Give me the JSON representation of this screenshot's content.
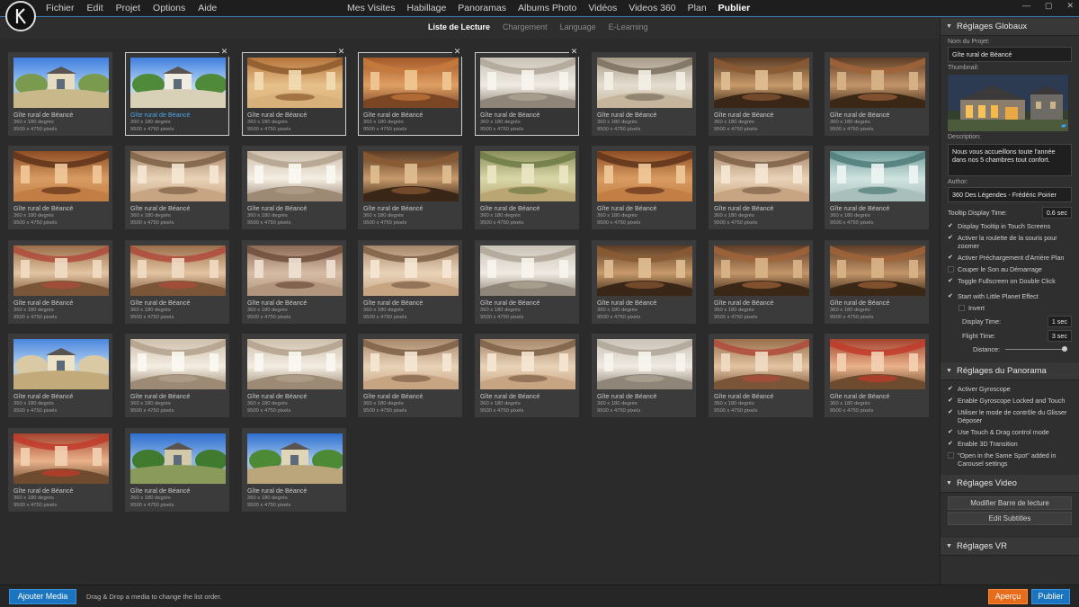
{
  "menu": {
    "left": [
      "Fichier",
      "Edit",
      "Projet",
      "Options",
      "Aide"
    ],
    "center": [
      "Mes Visites",
      "Habillage",
      "Panoramas",
      "Albums Photo",
      "Vidéos",
      "Videos 360",
      "Plan",
      "Publier"
    ],
    "active": "Publier"
  },
  "subtabs": {
    "items": [
      "Liste de Lecture",
      "Chargement",
      "Language",
      "E-Learning"
    ],
    "active": "Liste de Lecture"
  },
  "window_controls": [
    "—",
    "▢",
    "✕"
  ],
  "media": {
    "title": "Gîte rural de Béancé",
    "line2": "360 x 180 degrés",
    "line3": "9500 x 4750 pixels",
    "items": [
      {
        "scene": "ext-garden",
        "selected": false,
        "closable": false
      },
      {
        "scene": "ext-door",
        "selected": true,
        "blue": true,
        "closable": true
      },
      {
        "scene": "int-warm",
        "selected": true,
        "closable": true
      },
      {
        "scene": "int-orange",
        "selected": true,
        "closable": true
      },
      {
        "scene": "int-white",
        "selected": true,
        "closable": true
      },
      {
        "scene": "int-kitchen",
        "selected": false,
        "closable": false
      },
      {
        "scene": "int-beams",
        "selected": false,
        "closable": false
      },
      {
        "scene": "int-beams2",
        "selected": false,
        "closable": false
      },
      {
        "scene": "int-stairs",
        "selected": false
      },
      {
        "scene": "int-room",
        "selected": false
      },
      {
        "scene": "int-light",
        "selected": false
      },
      {
        "scene": "int-beams",
        "selected": false
      },
      {
        "scene": "int-green",
        "selected": false
      },
      {
        "scene": "int-stairs",
        "selected": false
      },
      {
        "scene": "int-room",
        "selected": false
      },
      {
        "scene": "int-teal",
        "selected": false
      },
      {
        "scene": "int-bed",
        "selected": false
      },
      {
        "scene": "int-bed",
        "selected": false
      },
      {
        "scene": "int-attic",
        "selected": false
      },
      {
        "scene": "int-room",
        "selected": false
      },
      {
        "scene": "int-white",
        "selected": false
      },
      {
        "scene": "int-beams",
        "selected": false
      },
      {
        "scene": "int-beams2",
        "selected": false
      },
      {
        "scene": "int-beams2",
        "selected": false
      },
      {
        "scene": "ext-court",
        "selected": false
      },
      {
        "scene": "int-light",
        "selected": false
      },
      {
        "scene": "int-light",
        "selected": false
      },
      {
        "scene": "int-room",
        "selected": false
      },
      {
        "scene": "int-room",
        "selected": false
      },
      {
        "scene": "int-white",
        "selected": false
      },
      {
        "scene": "int-bed",
        "selected": false
      },
      {
        "scene": "int-red",
        "selected": false
      },
      {
        "scene": "int-red",
        "selected": false
      },
      {
        "scene": "ext-garden2",
        "selected": false
      },
      {
        "scene": "ext-path",
        "selected": false
      }
    ]
  },
  "panel": {
    "global_title": "Réglages Globaux",
    "project_name_label": "Nom du Projet:",
    "project_name": "Gîte rural de Béancé",
    "thumbnail_label": "Thumbnail:",
    "description_label": "Description:",
    "description": "Nous vous accueillons toute l'année dans nos 5 chambres tout confort.",
    "author_label": "Author:",
    "author": "360 Des Légendes - Frédéric Poirier",
    "tooltip_label": "Tooltip Display Time:",
    "tooltip_value": "0.6 sec",
    "global_checks": [
      {
        "label": "Display Tooltip in Touch Screens",
        "checked": true
      },
      {
        "label": "Activer la roulette de la souris pour zoomer",
        "checked": true
      },
      {
        "label": "Activer Préchargement d'Arrière Plan",
        "checked": true
      },
      {
        "label": "Couper le Son au Démarrage",
        "checked": false
      },
      {
        "label": "Toggle Fullscreen on Double Click",
        "checked": true
      }
    ],
    "little_planet_label": "Start with Little Planet Effect",
    "invert_label": "Invert",
    "display_time_label": "Display Time:",
    "display_time_value": "1 sec",
    "flight_time_label": "Flight Time:",
    "flight_time_value": "3 sec",
    "distance_label": "Distance:",
    "panorama_title": "Réglages du Panorama",
    "panorama_checks": [
      {
        "label": "Activer Gyroscope",
        "checked": true
      },
      {
        "label": "Enable Gyroscope Locked and Touch",
        "checked": true
      },
      {
        "label": "Utiliser le mode de contrôle du Glisser Déposer",
        "checked": true
      },
      {
        "label": "Use Touch & Drag control mode",
        "checked": true
      },
      {
        "label": "Enable 3D Transition",
        "checked": true
      },
      {
        "label": "\"Open in the Same Spot\" added in Carousel settings",
        "checked": false
      }
    ],
    "video_title": "Réglages Video",
    "video_btn1": "Modifier Barre de lecture",
    "video_btn2": "Edit Subtitles",
    "vr_title": "Réglages VR"
  },
  "bottom": {
    "add_media": "Ajouter Media",
    "hint": "Drag & Drop a media to change the list order.",
    "preview": "Aperçu",
    "publish": "Publier"
  },
  "colors": {
    "accent_blue": "#1b74c0",
    "accent_orange": "#e86a1b",
    "selected_text": "#4aa6e8"
  }
}
